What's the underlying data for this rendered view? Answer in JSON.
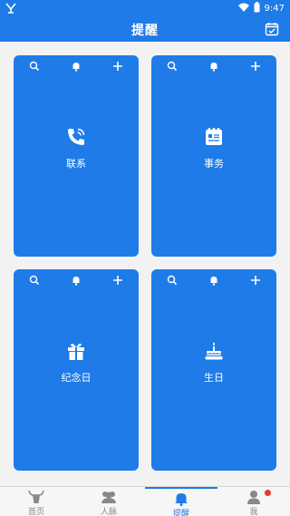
{
  "status": {
    "time": "9:47"
  },
  "header": {
    "title": "提醒"
  },
  "cards": [
    {
      "label": "联系",
      "icon": "phone-icon"
    },
    {
      "label": "事务",
      "icon": "notepad-icon"
    },
    {
      "label": "纪念日",
      "icon": "gift-icon"
    },
    {
      "label": "生日",
      "icon": "cake-icon"
    }
  ],
  "tabs": [
    {
      "label": "首页",
      "icon": "home-bull-icon"
    },
    {
      "label": "人脉",
      "icon": "people-icon"
    },
    {
      "label": "提醒",
      "icon": "bell-icon",
      "active": true
    },
    {
      "label": "我",
      "icon": "person-icon"
    }
  ],
  "colors": {
    "primary": "#1e7be8",
    "badge": "#e53935"
  }
}
